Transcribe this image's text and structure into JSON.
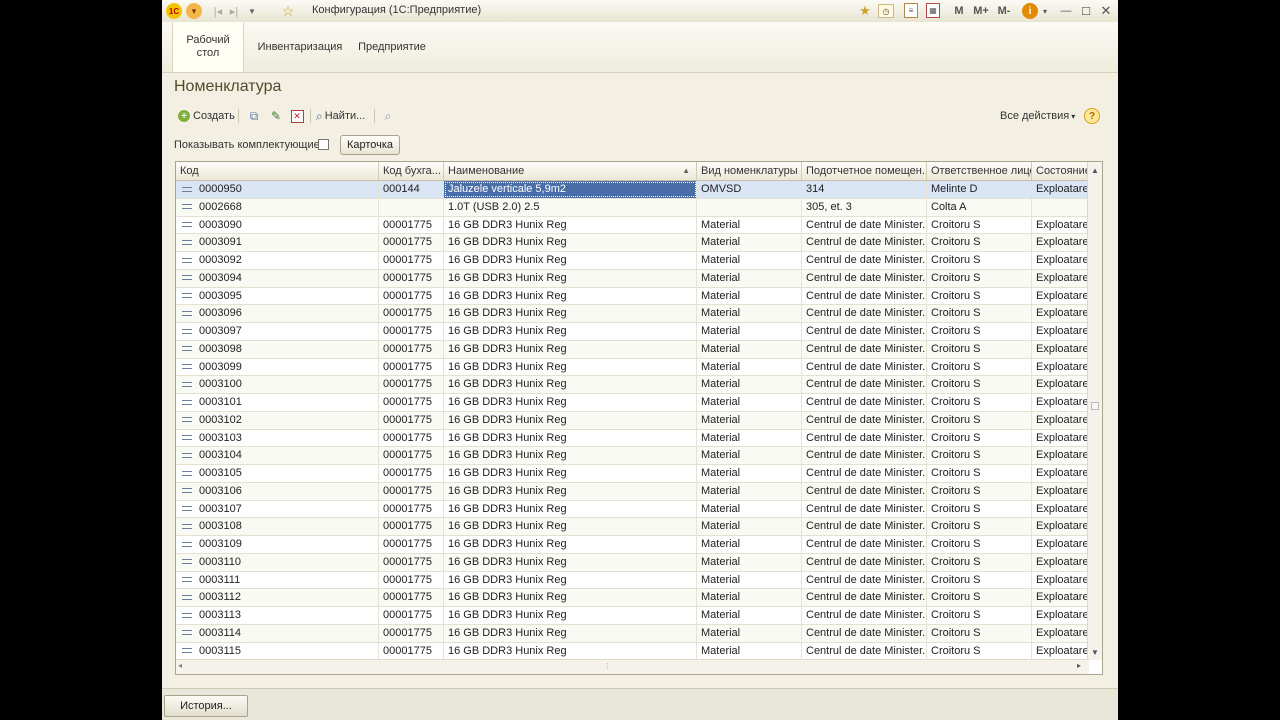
{
  "window": {
    "title": "Конфигурация (1С:Предприятие)",
    "logo": "1C",
    "fav_icon": "star-icon",
    "toolbar_right": {
      "m": "M",
      "m_plus": "M+",
      "m_minus": "M-",
      "info": "i"
    }
  },
  "sections": [
    {
      "label": "Рабочий стол"
    },
    {
      "label": "Инвентаризация"
    },
    {
      "label": "Предприятие"
    }
  ],
  "form": {
    "title": "Номенклатура",
    "toolbar": {
      "create": "Создать",
      "find": "Найти...",
      "all_actions": "Все действия",
      "help": "?"
    },
    "show_components_label": "Показывать комплектующие:",
    "show_components_checked": false,
    "card_button": "Карточка"
  },
  "table": {
    "columns": [
      "Код",
      "Код бухга...",
      "Наименование",
      "Вид номенклатуры",
      "Подотчетное помещен...",
      "Ответственное лицо",
      "Состояние"
    ],
    "selected_row": 0,
    "rows": [
      [
        "0000950",
        "000144",
        "Jaluzele verticale 5,9m2",
        "OMVSD",
        "314",
        "Melinte D",
        "Exploatare"
      ],
      [
        "0002668",
        "",
        "1.0T (USB 2.0) 2.5",
        "",
        "305, et. 3",
        "Colta A",
        ""
      ],
      [
        "0003090",
        "00001775",
        "16 GB DDR3 Hunix Reg",
        "Material",
        "Centrul de date Minister...",
        "Croitoru S",
        "Exploatare"
      ],
      [
        "0003091",
        "00001775",
        "16 GB DDR3 Hunix Reg",
        "Material",
        "Centrul de date Minister...",
        "Croitoru S",
        "Exploatare"
      ],
      [
        "0003092",
        "00001775",
        "16 GB DDR3 Hunix Reg",
        "Material",
        "Centrul de date Minister...",
        "Croitoru S",
        "Exploatare"
      ],
      [
        "0003094",
        "00001775",
        "16 GB DDR3 Hunix Reg",
        "Material",
        "Centrul de date Minister...",
        "Croitoru S",
        "Exploatare"
      ],
      [
        "0003095",
        "00001775",
        "16 GB DDR3 Hunix Reg",
        "Material",
        "Centrul de date Minister...",
        "Croitoru S",
        "Exploatare"
      ],
      [
        "0003096",
        "00001775",
        "16 GB DDR3 Hunix Reg",
        "Material",
        "Centrul de date Minister...",
        "Croitoru S",
        "Exploatare"
      ],
      [
        "0003097",
        "00001775",
        "16 GB DDR3 Hunix Reg",
        "Material",
        "Centrul de date Minister...",
        "Croitoru S",
        "Exploatare"
      ],
      [
        "0003098",
        "00001775",
        "16 GB DDR3 Hunix Reg",
        "Material",
        "Centrul de date Minister...",
        "Croitoru S",
        "Exploatare"
      ],
      [
        "0003099",
        "00001775",
        "16 GB DDR3 Hunix Reg",
        "Material",
        "Centrul de date Minister...",
        "Croitoru S",
        "Exploatare"
      ],
      [
        "0003100",
        "00001775",
        "16 GB DDR3 Hunix Reg",
        "Material",
        "Centrul de date Minister...",
        "Croitoru S",
        "Exploatare"
      ],
      [
        "0003101",
        "00001775",
        "16 GB DDR3 Hunix Reg",
        "Material",
        "Centrul de date Minister...",
        "Croitoru S",
        "Exploatare"
      ],
      [
        "0003102",
        "00001775",
        "16 GB DDR3 Hunix Reg",
        "Material",
        "Centrul de date Minister...",
        "Croitoru S",
        "Exploatare"
      ],
      [
        "0003103",
        "00001775",
        "16 GB DDR3 Hunix Reg",
        "Material",
        "Centrul de date Minister...",
        "Croitoru S",
        "Exploatare"
      ],
      [
        "0003104",
        "00001775",
        "16 GB DDR3 Hunix Reg",
        "Material",
        "Centrul de date Minister...",
        "Croitoru S",
        "Exploatare"
      ],
      [
        "0003105",
        "00001775",
        "16 GB DDR3 Hunix Reg",
        "Material",
        "Centrul de date Minister...",
        "Croitoru S",
        "Exploatare"
      ],
      [
        "0003106",
        "00001775",
        "16 GB DDR3 Hunix Reg",
        "Material",
        "Centrul de date Minister...",
        "Croitoru S",
        "Exploatare"
      ],
      [
        "0003107",
        "00001775",
        "16 GB DDR3 Hunix Reg",
        "Material",
        "Centrul de date Minister...",
        "Croitoru S",
        "Exploatare"
      ],
      [
        "0003108",
        "00001775",
        "16 GB DDR3 Hunix Reg",
        "Material",
        "Centrul de date Minister...",
        "Croitoru S",
        "Exploatare"
      ],
      [
        "0003109",
        "00001775",
        "16 GB DDR3 Hunix Reg",
        "Material",
        "Centrul de date Minister...",
        "Croitoru S",
        "Exploatare"
      ],
      [
        "0003110",
        "00001775",
        "16 GB DDR3 Hunix Reg",
        "Material",
        "Centrul de date Minister...",
        "Croitoru S",
        "Exploatare"
      ],
      [
        "0003111",
        "00001775",
        "16 GB DDR3 Hunix Reg",
        "Material",
        "Centrul de date Minister...",
        "Croitoru S",
        "Exploatare"
      ],
      [
        "0003112",
        "00001775",
        "16 GB DDR3 Hunix Reg",
        "Material",
        "Centrul de date Minister...",
        "Croitoru S",
        "Exploatare"
      ],
      [
        "0003113",
        "00001775",
        "16 GB DDR3 Hunix Reg",
        "Material",
        "Centrul de date Minister...",
        "Croitoru S",
        "Exploatare"
      ],
      [
        "0003114",
        "00001775",
        "16 GB DDR3 Hunix Reg",
        "Material",
        "Centrul de date Minister...",
        "Croitoru S",
        "Exploatare"
      ],
      [
        "0003115",
        "00001775",
        "16 GB DDR3 Hunix Reg",
        "Material",
        "Centrul de date Minister...",
        "Croitoru S",
        "Exploatare"
      ]
    ]
  },
  "status": {
    "history_button": "История..."
  },
  "colors": {
    "window_bg": "#f3f0e3",
    "selected_row": "#d9e4f4",
    "current_cell": "#4a6ea8",
    "title_text": "#4d4d2a"
  }
}
